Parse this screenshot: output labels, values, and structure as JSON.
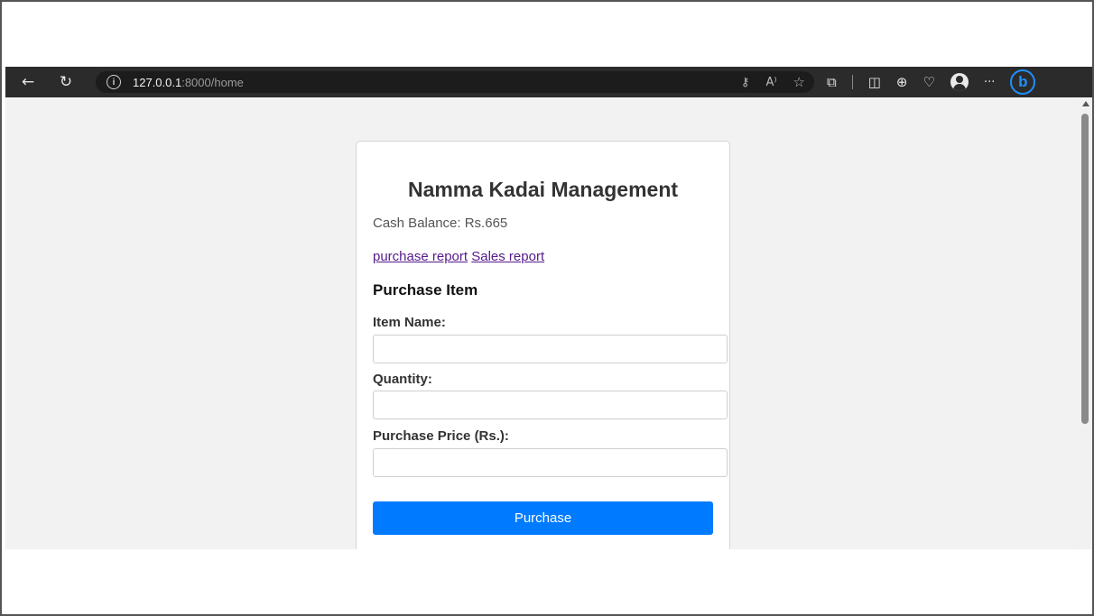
{
  "browser": {
    "url_host": "127.0.0.1",
    "url_rest": ":8000/home",
    "icons": {
      "back": "back-arrow-icon",
      "refresh": "refresh-icon",
      "info": "info-icon",
      "key": "key-icon",
      "read_aloud": "read-aloud-icon",
      "favorite": "star-icon",
      "extensions": "puzzle-icon",
      "split": "split-screen-icon",
      "collections": "collections-icon",
      "health": "browser-essentials-icon",
      "profile": "profile-avatar-icon",
      "more": "more-icon",
      "bing": "bing-copilot-icon"
    },
    "glyphs": {
      "back": "←",
      "refresh": "↻",
      "info": "i",
      "key": "⚷",
      "read_aloud": "A⁾",
      "favorite": "☆",
      "extensions": "⧉",
      "split": "◫",
      "collections": "⊕",
      "health": "♡",
      "more": "···",
      "bing": "b"
    }
  },
  "page": {
    "title": "Namma Kadai Management",
    "cash_balance": "Cash Balance: Rs.665",
    "links": {
      "purchase_report": "purchase report",
      "sales_report": "Sales report"
    },
    "section_title": "Purchase Item",
    "form": {
      "item_name_label": "Item Name:",
      "item_name_value": "",
      "quantity_label": "Quantity:",
      "quantity_value": "",
      "price_label": "Purchase Price (Rs.):",
      "price_value": "",
      "submit_label": "Purchase"
    }
  },
  "colors": {
    "toolbar_bg": "#2b2b2b",
    "page_bg": "#f2f2f2",
    "button_bg": "#007bff",
    "link_visited": "#551a8b",
    "bing_accent": "#1e90ff"
  }
}
